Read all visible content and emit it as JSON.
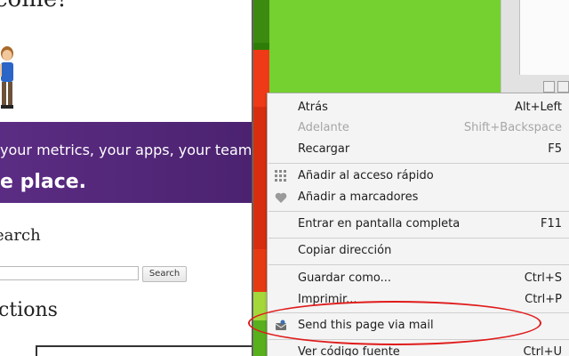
{
  "left_page": {
    "welcome_text": "come!",
    "banner_tagline": "your metrics, your apps, your team",
    "banner_bold": "e place.",
    "search_title": "earch",
    "search_button": "Search",
    "sections_title": "ctions"
  },
  "context_menu": {
    "items": [
      {
        "label": "Atrás",
        "shortcut": "Alt+Left",
        "disabled": false
      },
      {
        "label": "Adelante",
        "shortcut": "Shift+Backspace",
        "disabled": true
      },
      {
        "label": "Recargar",
        "shortcut": "F5",
        "disabled": false
      },
      {
        "label": "Añadir al acceso rápido",
        "shortcut": "",
        "icon": "speed-dial-grid-icon"
      },
      {
        "label": "Añadir a marcadores",
        "shortcut": "",
        "icon": "heart-icon"
      },
      {
        "label": "Entrar en pantalla completa",
        "shortcut": "F11"
      },
      {
        "label": "Copiar dirección",
        "shortcut": ""
      },
      {
        "label": "Guardar como...",
        "shortcut": "Ctrl+S"
      },
      {
        "label": "Imprimir...",
        "shortcut": "Ctrl+P"
      },
      {
        "label": "Send this page via mail",
        "shortcut": "",
        "icon": "mail-extension-icon"
      },
      {
        "label": "Ver código fuente",
        "shortcut": "Ctrl+U"
      }
    ]
  },
  "colors": {
    "banner": "#5b2c83",
    "highlight_ellipse": "#e01b1b",
    "green_pane": "#74d12f"
  }
}
